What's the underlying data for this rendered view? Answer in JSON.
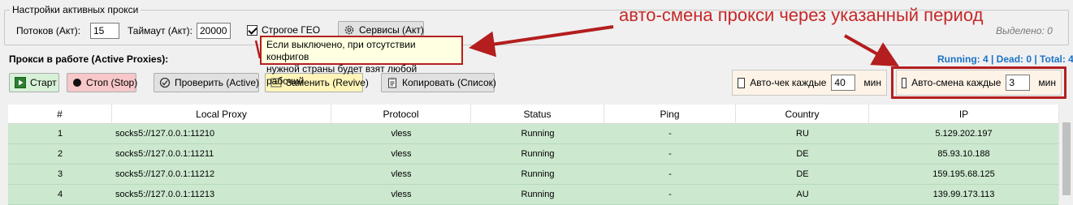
{
  "settings": {
    "group_title": "Настройки активных прокси",
    "threads_label": "Потоков (Акт):",
    "threads_value": "15",
    "timeout_label": "Таймаут (Акт):",
    "timeout_value": "20000",
    "strict_geo_label": "Строгое ГЕО",
    "strict_geo_checked": true,
    "services_button": "Сервисы (Акт)",
    "selected_label": "Выделено: 0"
  },
  "annotations": {
    "big_text": "авто-смена прокси через указанный период",
    "tooltip_line1": "Если выключено, при отсутствии конфигов",
    "tooltip_line2": "нужной страны будет взят любой рабочий",
    "color": "#b41e1e"
  },
  "proxies": {
    "section_title": "Прокси в работе (Active Proxies):",
    "stats": "Running: 4 | Dead: 0 | Total: 4"
  },
  "toolbar": {
    "start_label": "Старт",
    "stop_label": "Стоп (Stop)",
    "check_label": "Проверить (Active)",
    "replace_label": "Заменить (Revive)",
    "copy_label": "Копировать (Список)",
    "autocheck_label": "Авто-чек каждые",
    "autocheck_value": "40",
    "autocheck_unit": "мин",
    "autoswitch_label": "Авто-смена каждые",
    "autoswitch_value": "3",
    "autoswitch_unit": "мин"
  },
  "table": {
    "columns": [
      "#",
      "Local Proxy",
      "Protocol",
      "Status",
      "Ping",
      "Country",
      "IP"
    ],
    "rows": [
      [
        "1",
        "socks5://127.0.0.1:11210",
        "vless",
        "Running",
        "-",
        "RU",
        "5.129.202.197"
      ],
      [
        "2",
        "socks5://127.0.0.1:11211",
        "vless",
        "Running",
        "-",
        "DE",
        "85.93.10.188"
      ],
      [
        "3",
        "socks5://127.0.0.1:11212",
        "vless",
        "Running",
        "-",
        "DE",
        "159.195.68.125"
      ],
      [
        "4",
        "socks5://127.0.0.1:11213",
        "vless",
        "Running",
        "-",
        "AU",
        "139.99.173.113"
      ]
    ]
  }
}
